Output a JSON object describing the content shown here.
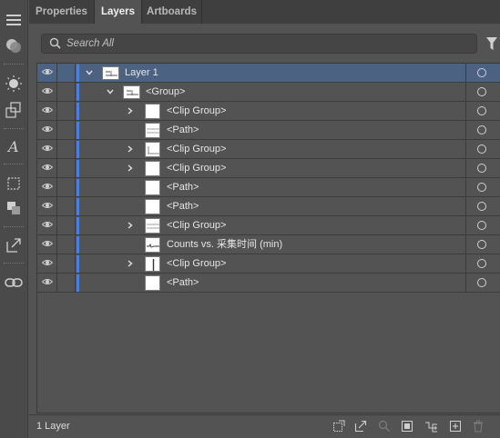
{
  "tabs": [
    {
      "label": "Properties",
      "active": false
    },
    {
      "label": "Layers",
      "active": true
    },
    {
      "label": "Artboards",
      "active": false
    }
  ],
  "search": {
    "placeholder": "Search All"
  },
  "layers": [
    {
      "label": "Layer 1",
      "expanded": true,
      "selected": true
    },
    {
      "label": "<Group>",
      "expanded": true
    },
    {
      "label": "<Clip Group>",
      "has_children": true
    },
    {
      "label": "<Path>"
    },
    {
      "label": "<Clip Group>",
      "has_children": true
    },
    {
      "label": "<Clip Group>",
      "has_children": true
    },
    {
      "label": "<Path>"
    },
    {
      "label": "<Path>"
    },
    {
      "label": "<Clip Group>",
      "has_children": true
    },
    {
      "label": "Counts vs. 采集时间 (min)"
    },
    {
      "label": "<Clip Group>",
      "has_children": true
    },
    {
      "label": "<Path>"
    }
  ],
  "footer": {
    "layer_count": "1 Layer"
  },
  "colors": {
    "layer_color": "#4a7ee0",
    "selected_row": "#4b6282",
    "panel_bg": "#535353"
  },
  "toolbar_icons": [
    "menu-icon",
    "appearance-icon",
    "sun-icon",
    "transform-icon",
    "character-icon",
    "artboard-icon",
    "pathfinder-icon",
    "export-icon",
    "links-icon"
  ],
  "footer_icons": [
    "collect-for-export-icon",
    "export-icon",
    "locate-object-icon",
    "make-clipping-mask-icon",
    "new-sublayer-icon",
    "new-layer-icon",
    "delete-icon"
  ]
}
